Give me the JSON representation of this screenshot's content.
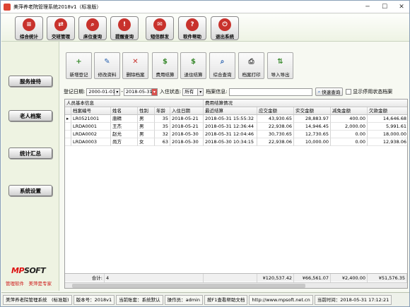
{
  "window": {
    "title": "美萍养老院管理系统2018v1（标准版）",
    "minimize": "─",
    "maximize": "☐",
    "close": "✕"
  },
  "toolbar": [
    {
      "label": "综合统计",
      "glyph": "≡",
      "color": "#c8322c"
    },
    {
      "label": "交班管理",
      "glyph": "⇄",
      "color": "#c8322c"
    },
    {
      "label": "床位查询",
      "glyph": "⌕",
      "color": "#c8322c"
    },
    {
      "label": "提醒查询",
      "glyph": "!",
      "color": "#c8322c"
    },
    {
      "label": "短信群发",
      "glyph": "✉",
      "color": "#c8322c"
    },
    {
      "label": "软件帮助",
      "glyph": "?",
      "color": "#c8322c"
    },
    {
      "label": "退出系统",
      "glyph": "⏻",
      "color": "#c8322c"
    }
  ],
  "sidebar": {
    "items": [
      "服务接待",
      "老人档案",
      "统计汇总",
      "系统设置"
    ],
    "logo_mp": "MP",
    "logo_soft": "SOFT",
    "logo_sub": "管理软件　美萍是专家"
  },
  "actions": [
    {
      "label": "新增登记",
      "glyph": "+",
      "color": "#3a8a2e"
    },
    {
      "label": "修改资料",
      "glyph": "✎",
      "color": "#2a62b0"
    },
    {
      "label": "删除档案",
      "glyph": "✕",
      "color": "#c8322c"
    },
    {
      "label": "费用结算",
      "glyph": "$",
      "color": "#3a8a2e"
    },
    {
      "label": "退住结算",
      "glyph": "$",
      "color": "#3a8a2e"
    },
    {
      "label": "综合查询",
      "glyph": "⌕",
      "color": "#2a62b0"
    },
    {
      "label": "档案打印",
      "glyph": "⎙",
      "color": "#444"
    },
    {
      "label": "导入导出",
      "glyph": "⇅",
      "color": "#3a8a2e"
    }
  ],
  "filter": {
    "date_label": "登记日期:",
    "date_from": "2000-01-01",
    "dash": "-",
    "date_to": "2018-05-31",
    "status_label": "入住状态:",
    "status_value": "所有",
    "search_label": "档案信息:",
    "search_value": "",
    "quick_search": "快速查询",
    "show_disabled": "显示停用状态档案"
  },
  "table": {
    "group_left": "人员基本信息",
    "group_right": "费用结算情况",
    "columns": [
      "档案编号",
      "姓名",
      "性别",
      "年龄",
      "入住日期",
      "最近结算",
      "应交金额",
      "实交金额",
      "减免金额",
      "欠款金额"
    ],
    "rows": [
      [
        "LR0521001",
        "唐精",
        "男",
        "35",
        "2018-05-21",
        "2018-05-31 15:55:32",
        "43,930.65",
        "28,883.97",
        "400.00",
        "14,646.68"
      ],
      [
        "LRDA0001",
        "王杰",
        "男",
        "35",
        "2018-05-21",
        "2018-05-31 12:36:44",
        "22,938.06",
        "14,946.45",
        "2,000.00",
        "5,991.61"
      ],
      [
        "LRDA0002",
        "赵光",
        "男",
        "32",
        "2018-05-30",
        "2018-05-31 12:04:46",
        "30,730.65",
        "12,730.65",
        "0.00",
        "18,000.00"
      ],
      [
        "LRDA0003",
        "尚方",
        "女",
        "63",
        "2018-05-30",
        "2018-05-30 10:34:15",
        "22,938.06",
        "10,000.00",
        "0.00",
        "12,938.06"
      ]
    ],
    "footer": {
      "count_label": "合计:",
      "count": "4",
      "total_due": "¥120,537.42",
      "total_paid": "¥66,561.07",
      "total_reduce": "¥2,400.00",
      "total_owe": "¥51,576.35"
    }
  },
  "statusbar": [
    "美萍养老院管理系统　(标准版)",
    "版本号：2018v1",
    "当前账套：系统默认",
    "操作员：admin",
    "按F1查看帮助文档",
    "http://www.mpsoft.net.cn",
    "当前时间：2018-05-31 17:12:21"
  ]
}
